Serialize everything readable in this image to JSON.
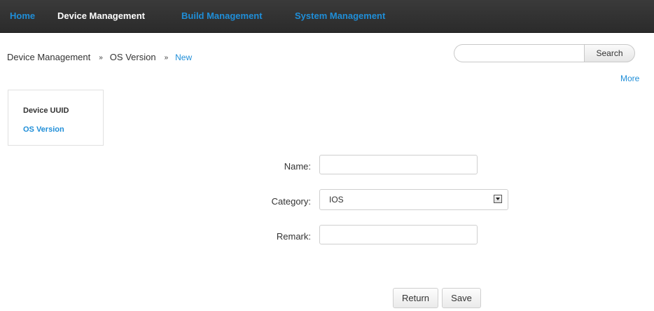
{
  "nav": {
    "home": "Home",
    "device_management": "Device Management",
    "build_management": "Build Management",
    "system_management": "System Management"
  },
  "breadcrumb": {
    "items": [
      "Device Management",
      "OS Version",
      "New"
    ],
    "separator": "»"
  },
  "search": {
    "value": "",
    "placeholder": "",
    "button_label": "Search"
  },
  "more_label": "More",
  "sidebar": {
    "items": [
      {
        "label": "Device UUID",
        "active": false
      },
      {
        "label": "OS Version",
        "active": true
      }
    ]
  },
  "form": {
    "name_label": "Name:",
    "name_value": "",
    "category_label": "Category:",
    "category_value": "IOS",
    "remark_label": "Remark:",
    "remark_value": ""
  },
  "actions": {
    "return_label": "Return",
    "save_label": "Save"
  },
  "colors": {
    "accent": "#1f8ed8",
    "nav_background": "#2b2b2b"
  }
}
